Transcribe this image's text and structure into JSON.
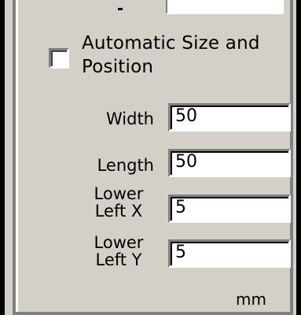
{
  "auto_size": {
    "label": "Automatic Size and Position",
    "checked": false
  },
  "fields": {
    "width": {
      "label": "Width",
      "value": "50"
    },
    "length": {
      "label": "Length",
      "value": "50"
    },
    "lower_left_x": {
      "label_line1": "Lower",
      "label_line2": "Left X",
      "value": "5"
    },
    "lower_left_y": {
      "label_line1": "Lower",
      "label_line2": "Left Y",
      "value": "5"
    }
  },
  "unit": "mm",
  "colors": {
    "panel": "#d4d0c8",
    "shadow": "#808080",
    "field": "#ffffff"
  }
}
